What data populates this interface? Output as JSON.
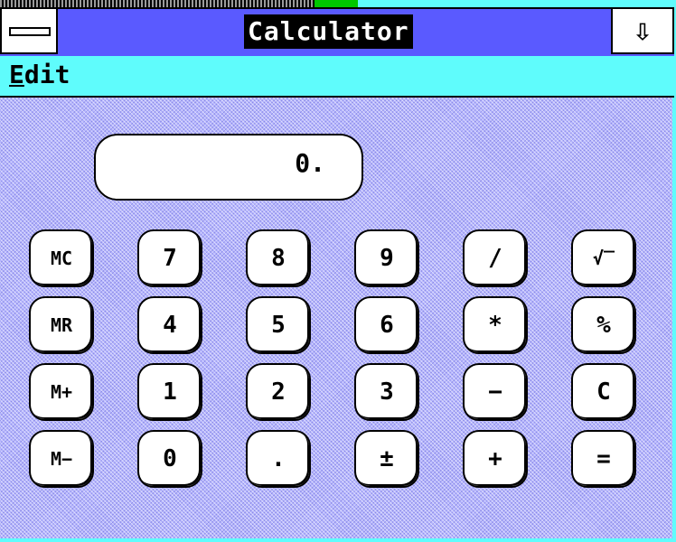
{
  "window": {
    "title": "Calculator",
    "menu": [
      {
        "label": "Edit",
        "accelerator": "E"
      }
    ]
  },
  "display": {
    "value": "0."
  },
  "keys": [
    [
      "MC",
      "7",
      "8",
      "9",
      "/",
      "√‾"
    ],
    [
      "MR",
      "4",
      "5",
      "6",
      "*",
      "%"
    ],
    [
      "M+",
      "1",
      "2",
      "3",
      "−",
      "C"
    ],
    [
      "M−",
      "0",
      ".",
      "±",
      "+",
      "="
    ]
  ],
  "colors": {
    "title_bar": "#5a5aff",
    "menu_bar": "#5ffcfc",
    "client_pattern": "#b4b4ff"
  },
  "icons": {
    "system_menu": "system-menu-icon",
    "minimize": "down-arrow-icon"
  }
}
